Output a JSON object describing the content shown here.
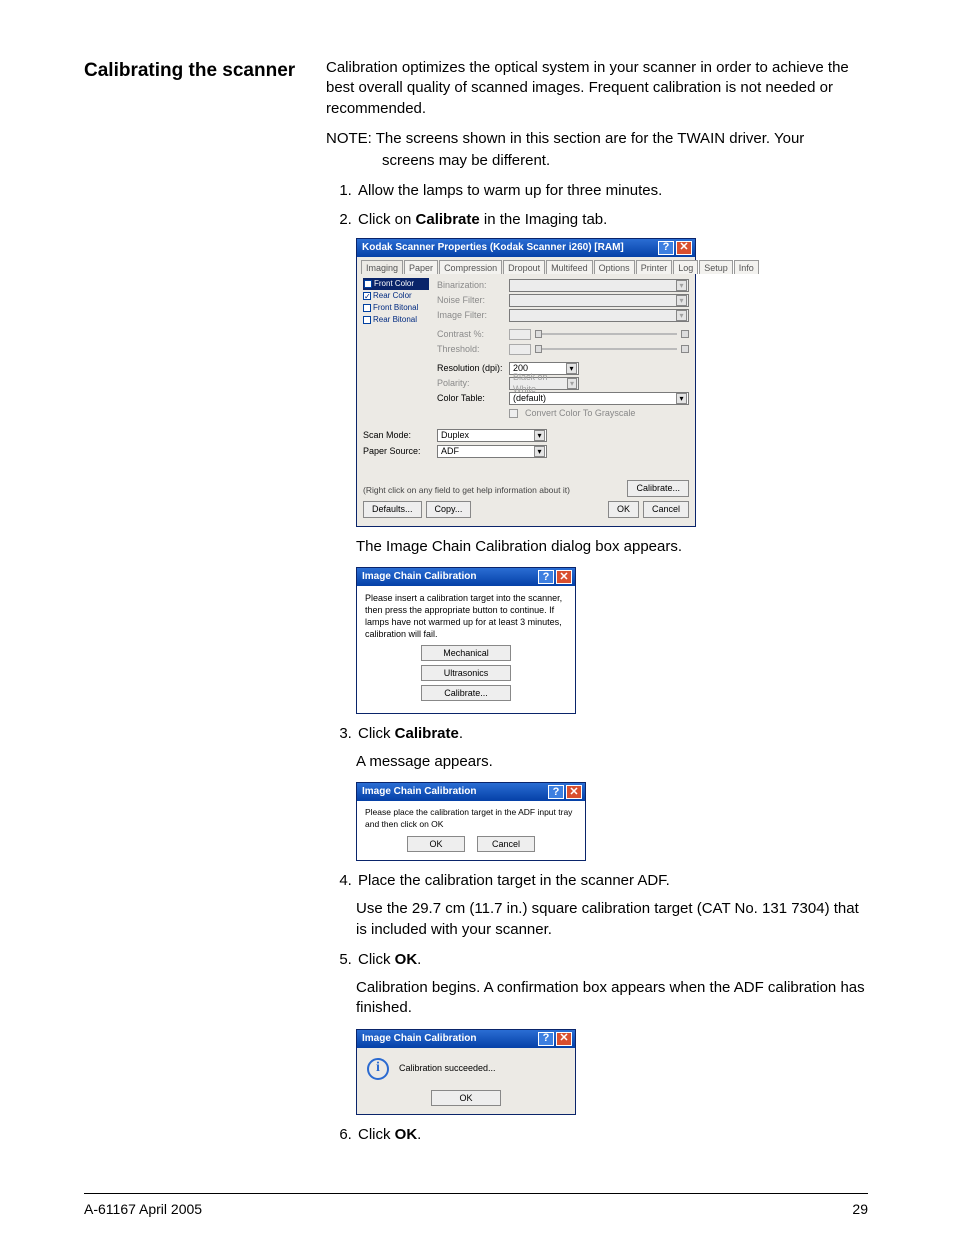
{
  "heading": "Calibrating the scanner",
  "intro": "Calibration optimizes the optical system in your scanner in order to achieve the best overall quality of scanned images. Frequent calibration is not needed or recommended.",
  "note_prefix": "NOTE:",
  "note_a": "The screens shown in this section are for the TWAIN driver. Your",
  "note_b": "screens may be different.",
  "step1": "Allow the lamps to warm up for three minutes.",
  "step2_a": "Click on ",
  "step2_b": "Calibrate",
  "step2_c": " in the Imaging tab.",
  "after_props": "The Image Chain Calibration dialog box appears.",
  "step3_a": "Click ",
  "step3_b": "Calibrate",
  "step3_c": ".",
  "after_step3": "A message appears.",
  "step4": "Place the calibration target in the scanner ADF.",
  "step4_sub": "Use the 29.7 cm (11.7 in.) square calibration target (CAT No. 131 7304) that is included with your scanner.",
  "step5_a": "Click ",
  "step5_b": "OK",
  "step5_c": ".",
  "step5_sub": "Calibration begins. A confirmation box appears when the ADF calibration has finished.",
  "step6_a": "Click ",
  "step6_b": "OK",
  "step6_c": ".",
  "props": {
    "title": "Kodak Scanner Properties (Kodak Scanner i260) [RAM]",
    "tabs": [
      "Imaging",
      "Paper",
      "Compression",
      "Dropout",
      "Multifeed",
      "Options",
      "Printer",
      "Log",
      "Setup",
      "Info"
    ],
    "sides": {
      "front_color": "Front Color",
      "rear_color": "Rear Color",
      "front_bitonal": "Front Bitonal",
      "rear_bitonal": "Rear Bitonal"
    },
    "labels": {
      "binarization": "Binarization:",
      "noise_filter": "Noise Filter:",
      "image_filter": "Image Filter:",
      "contrast": "Contrast %:",
      "threshold": "Threshold:",
      "resolution": "Resolution (dpi):",
      "polarity": "Polarity:",
      "color_table": "Color Table:",
      "convert": "Convert Color To Grayscale",
      "scan_mode": "Scan Mode:",
      "paper_source": "Paper Source:"
    },
    "values": {
      "resolution": "200",
      "polarity": "Black on White",
      "color_table": "(default)",
      "scan_mode": "Duplex",
      "paper_source": "ADF"
    },
    "hint": "(Right click on any field to get help information about it)",
    "buttons": {
      "defaults": "Defaults...",
      "copy": "Copy...",
      "calibrate": "Calibrate...",
      "ok": "OK",
      "cancel": "Cancel"
    }
  },
  "dlg1": {
    "title": "Image Chain Calibration",
    "msg": "Please insert a calibration target into the scanner, then press the appropriate button to continue.  If lamps have not warmed up for at least 3 minutes, calibration will fail.",
    "btn_mech": "Mechanical",
    "btn_ultra": "Ultrasonics",
    "btn_cal": "Calibrate..."
  },
  "dlg2": {
    "title": "Image Chain Calibration",
    "msg": "Please place the calibration target in the ADF input tray and then click on OK",
    "ok": "OK",
    "cancel": "Cancel"
  },
  "dlg3": {
    "title": "Image Chain Calibration",
    "msg": "Calibration succeeded...",
    "ok": "OK"
  },
  "footer": {
    "left": "A-61167    April 2005",
    "right": "29"
  }
}
